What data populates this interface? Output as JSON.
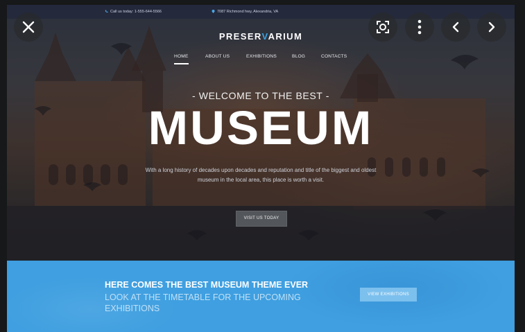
{
  "site": {
    "topbar": {
      "phone_text": "Call us today: 1-555-644-5566",
      "address_text": "7087 Richmond hwy, Alexandria, VA"
    },
    "logo": {
      "part1": "PRESER",
      "part2": "V",
      "part3": "ARIUM"
    },
    "nav": {
      "items": [
        {
          "label": "HOME",
          "active": true
        },
        {
          "label": "ABOUT US",
          "active": false
        },
        {
          "label": "EXHIBITIONS",
          "active": false
        },
        {
          "label": "BLOG",
          "active": false
        },
        {
          "label": "CONTACTS",
          "active": false
        }
      ]
    },
    "hero": {
      "eyebrow": "- WELCOME TO THE BEST -",
      "headline": "MUSEUM",
      "intro": "With a long history of decades upon decades and reputation and title of the biggest and oldest museum in the local area, this place is worth a visit.",
      "cta_label": "VISIT US TODAY"
    },
    "banner": {
      "title": "HERE COMES THE BEST MUSEUM THEME EVER",
      "subtitle": "LOOK AT THE TIMETABLE FOR THE UPCOMING EXHIBITIONS",
      "cta_label": "VIEW EXHIBITIONS"
    }
  },
  "viewer": {
    "controls": [
      "close-icon",
      "lens-search-icon",
      "more-vertical-icon",
      "chevron-left-icon",
      "chevron-right-icon"
    ]
  },
  "colors": {
    "accent_blue": "#3f9fe0",
    "logo_accent": "#3aa3e6",
    "viewer_background": "#161819"
  }
}
